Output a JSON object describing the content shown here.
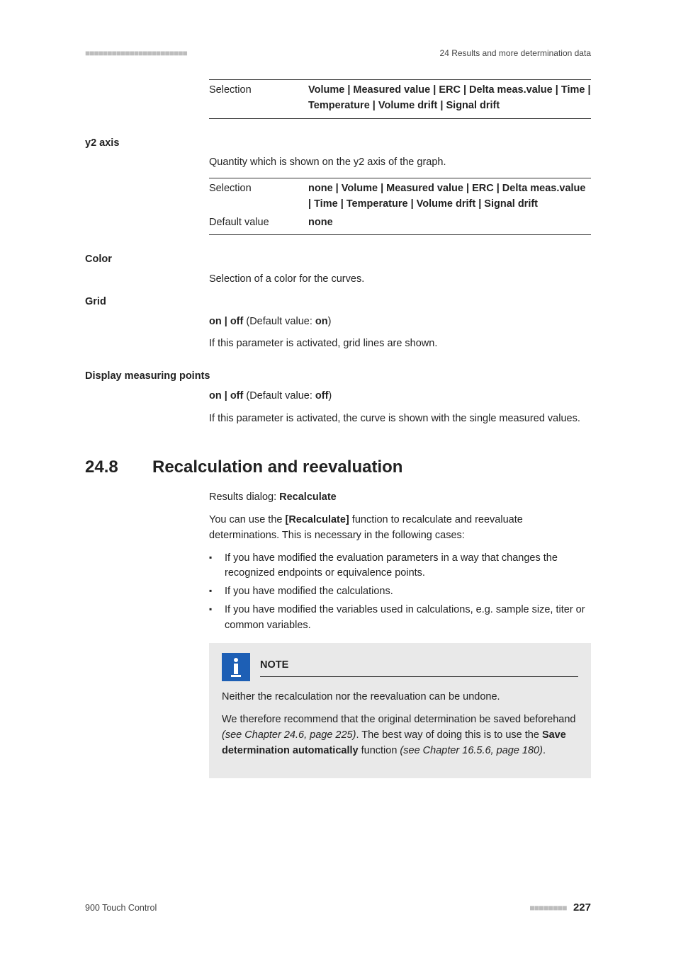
{
  "header": {
    "breadcrumb": "24 Results and more determination data",
    "dots": "■■■■■■■■■■■■■■■■■■■■■■■"
  },
  "top_table": {
    "label": "Selection",
    "value": "Volume | Measured value | ERC | Delta meas.value | Time | Temperature | Volume drift | Signal drift"
  },
  "y2": {
    "label": "y2 axis",
    "desc": "Quantity which is shown on the y2 axis of the graph.",
    "rows": [
      {
        "label": "Selection",
        "value": "none | Volume | Measured value | ERC | Delta meas.value | Time | Temperature | Volume drift | Signal drift"
      },
      {
        "label": "Default value",
        "value": "none"
      }
    ]
  },
  "color": {
    "label": "Color",
    "desc": "Selection of a color for the curves."
  },
  "grid": {
    "label": "Grid",
    "opts_pre": "on | off",
    "opts_mid": " (Default value: ",
    "opts_def": "on",
    "opts_post": ")",
    "desc": "If this parameter is activated, grid lines are shown."
  },
  "dmp": {
    "label": "Display measuring points",
    "opts_pre": "on | off",
    "opts_mid": " (Default value: ",
    "opts_def": "off",
    "opts_post": ")",
    "desc": "If this parameter is activated, the curve is shown with the single measured values."
  },
  "section": {
    "num": "24.8",
    "title": "Recalculation and reevaluation"
  },
  "recalc": {
    "dialog_pre": "Results dialog: ",
    "dialog_bold": "Recalculate",
    "intro_pre": "You can use the ",
    "intro_bold": "[Recalculate]",
    "intro_post": " function to recalculate and reevaluate determinations. This is necessary in the following cases:",
    "bullets": [
      "If you have modified the evaluation parameters in a way that changes the recognized endpoints or equivalence points.",
      "If you have modified the calculations.",
      "If you have modified the variables used in calculations, e.g. sample size, titer or common variables."
    ]
  },
  "note": {
    "title": "NOTE",
    "p1": "Neither the recalculation nor the reevaluation can be undone.",
    "p2_a": "We therefore recommend that the original determination be saved beforehand ",
    "p2_b": "(see Chapter 24.6, page 225)",
    "p2_c": ". The best way of doing this is to use the ",
    "p2_d": "Save determination automatically",
    "p2_e": " function ",
    "p2_f": "(see Chapter 16.5.6, page 180)",
    "p2_g": "."
  },
  "footer": {
    "product": "900 Touch Control",
    "dots": "■■■■■■■■",
    "page": "227"
  }
}
